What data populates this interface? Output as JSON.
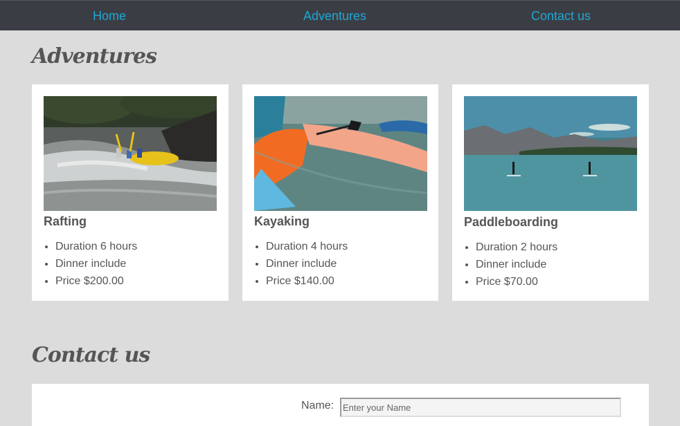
{
  "nav": {
    "home": "Home",
    "adventures": "Adventures",
    "contact": "Contact us"
  },
  "sections": {
    "adventures_title": "Adventures",
    "contact_title": "Contact us"
  },
  "adventures": [
    {
      "title": "Rafting",
      "details": [
        "Duration 6 hours",
        "Dinner include",
        "Price $200.00"
      ]
    },
    {
      "title": "Kayaking",
      "details": [
        "Duration 4 hours",
        "Dinner include",
        "Price $140.00"
      ]
    },
    {
      "title": "Paddleboarding",
      "details": [
        "Duration 2 hours",
        "Dinner include",
        "Price $70.00"
      ]
    }
  ],
  "contact_form": {
    "name_label": "Name:",
    "name_placeholder": "Enter your Name",
    "name_value": ""
  },
  "colors": {
    "nav_bg": "#3a3e44",
    "nav_link": "#1ea7d6",
    "page_bg": "#dcdcdc",
    "card_bg": "#ffffff",
    "text": "#555555"
  }
}
